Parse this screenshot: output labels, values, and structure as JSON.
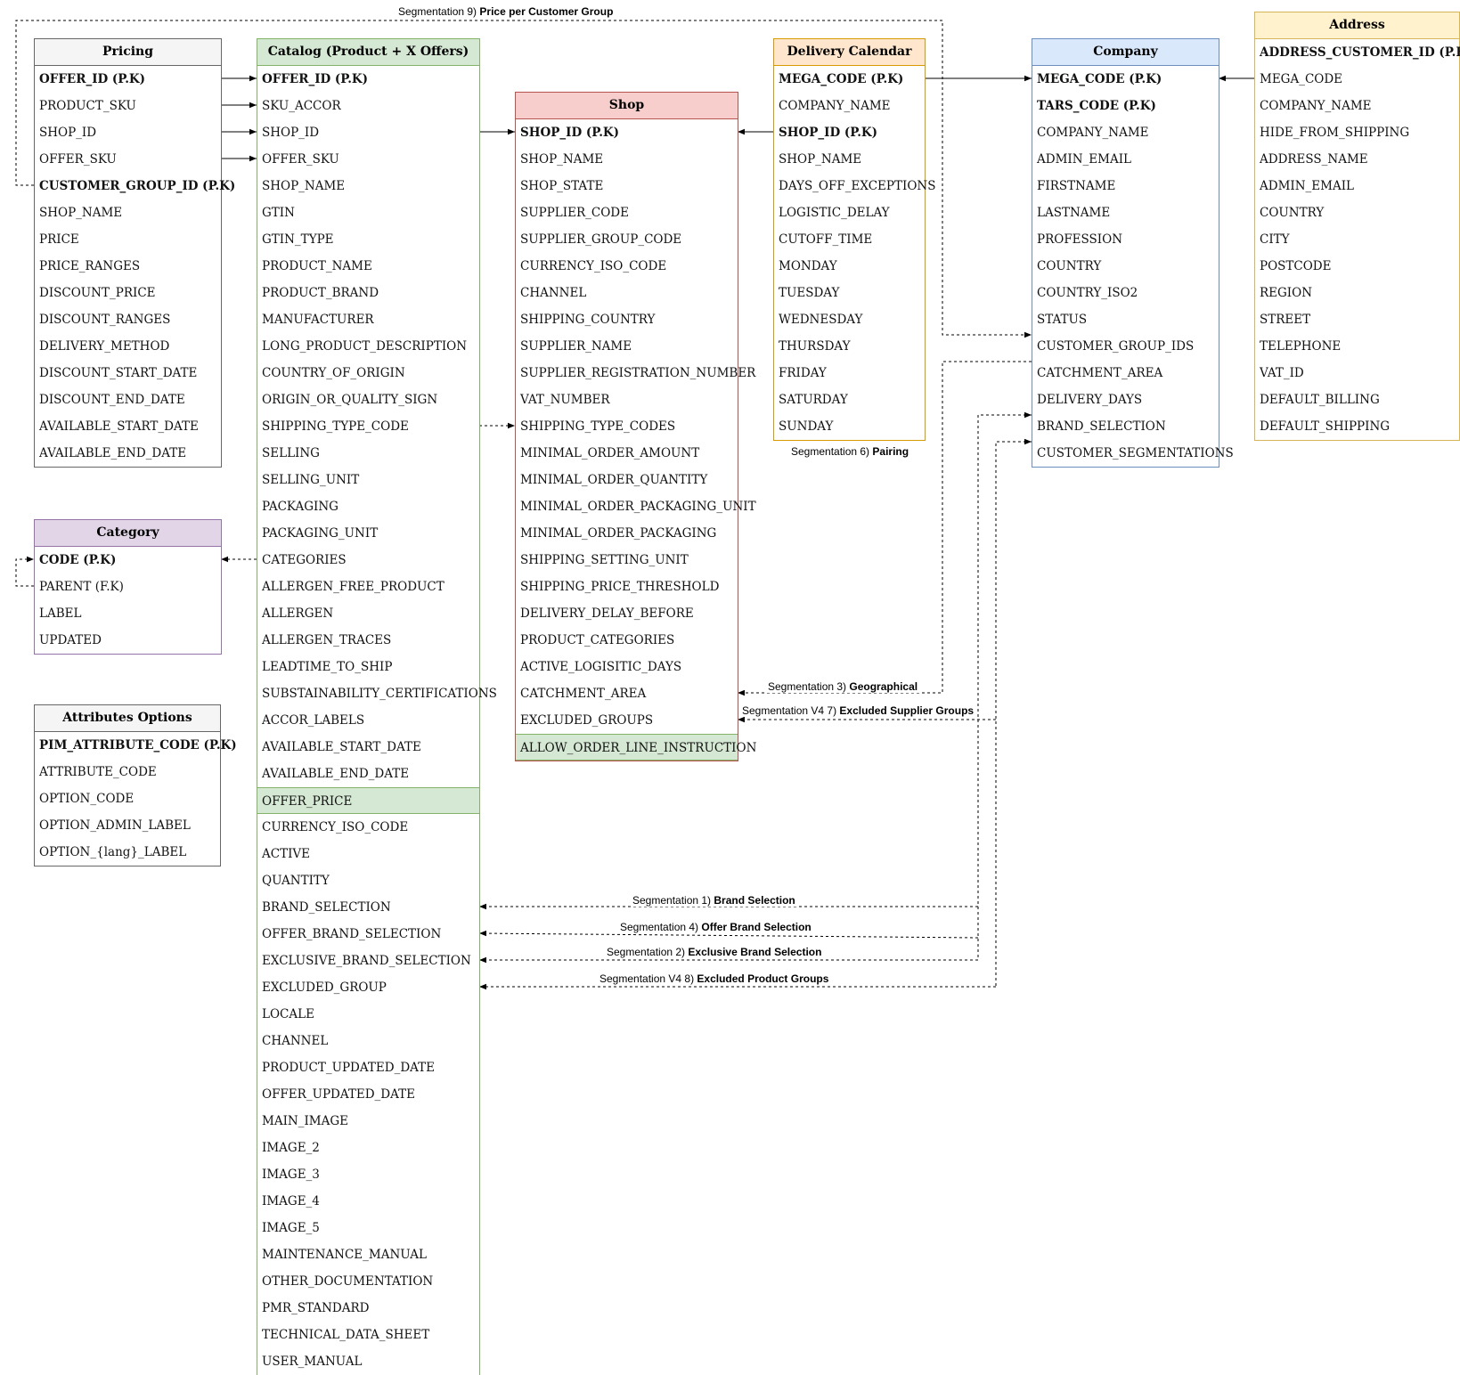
{
  "tables": {
    "pricing": {
      "title": "Pricing",
      "rows": [
        "OFFER_ID (P.K)",
        "PRODUCT_SKU",
        "SHOP_ID",
        "OFFER_SKU",
        "CUSTOMER_GROUP_ID (P.K)",
        "SHOP_NAME",
        "PRICE",
        "PRICE_RANGES",
        "DISCOUNT_PRICE",
        "DISCOUNT_RANGES",
        "DELIVERY_METHOD",
        "DISCOUNT_START_DATE",
        "DISCOUNT_END_DATE",
        "AVAILABLE_START_DATE",
        "AVAILABLE_END_DATE"
      ],
      "pk": [
        0,
        4
      ],
      "colors": {
        "header_bg": "#f5f5f5",
        "border": "#666666"
      }
    },
    "catalog": {
      "title": "Catalog (Product + X Offers)",
      "rows": [
        "OFFER_ID (P.K)",
        "SKU_ACCOR",
        "SHOP_ID",
        "OFFER_SKU",
        "SHOP_NAME",
        "GTIN",
        "GTIN_TYPE",
        "PRODUCT_NAME",
        "PRODUCT_BRAND",
        "MANUFACTURER",
        "LONG_PRODUCT_DESCRIPTION",
        "COUNTRY_OF_ORIGIN",
        "ORIGIN_OR_QUALITY_SIGN",
        "SHIPPING_TYPE_CODE",
        "SELLING",
        "SELLING_UNIT",
        "PACKAGING",
        "PACKAGING_UNIT",
        "CATEGORIES",
        "ALLERGEN_FREE_PRODUCT",
        "ALLERGEN",
        "ALLERGEN_TRACES",
        "LEADTIME_TO_SHIP",
        "SUBSTAINABILITY_CERTIFICATIONS",
        "ACCOR_LABELS",
        "AVAILABLE_START_DATE",
        "AVAILABLE_END_DATE",
        "OFFER_PRICE",
        "CURRENCY_ISO_CODE",
        "ACTIVE",
        "QUANTITY",
        "BRAND_SELECTION",
        "OFFER_BRAND_SELECTION",
        "EXCLUSIVE_BRAND_SELECTION",
        "EXCLUDED_GROUP",
        "LOCALE",
        "CHANNEL",
        "PRODUCT_UPDATED_DATE",
        "OFFER_UPDATED_DATE",
        "MAIN_IMAGE",
        "IMAGE_2",
        "IMAGE_3",
        "IMAGE_4",
        "IMAGE_5",
        "MAINTENANCE_MANUAL",
        "OTHER_DOCUMENTATION",
        "PMR_STANDARD",
        "TECHNICAL_DATA_SHEET",
        "USER_MANUAL"
      ],
      "pk": [
        0
      ],
      "band": [
        27
      ],
      "colors": {
        "header_bg": "#d5e8d4",
        "border": "#82b366"
      }
    },
    "shop": {
      "title": "Shop",
      "rows": [
        "SHOP_ID (P.K)",
        "SHOP_NAME",
        "SHOP_STATE",
        "SUPPLIER_CODE",
        "SUPPLIER_GROUP_CODE",
        "CURRENCY_ISO_CODE",
        "CHANNEL",
        "SHIPPING_COUNTRY",
        "SUPPLIER_NAME",
        "SUPPLIER_REGISTRATION_NUMBER",
        "VAT_NUMBER",
        "SHIPPING_TYPE_CODES",
        "MINIMAL_ORDER_AMOUNT",
        "MINIMAL_ORDER_QUANTITY",
        "MINIMAL_ORDER_PACKAGING_UNIT",
        "MINIMAL_ORDER_PACKAGING",
        "SHIPPING_SETTING_UNIT",
        "SHIPPING_PRICE_THRESHOLD",
        "DELIVERY_DELAY_BEFORE",
        "PRODUCT_CATEGORIES",
        "ACTIVE_LOGISITIC_DAYS",
        "CATCHMENT_AREA",
        "EXCLUDED_GROUPS",
        "ALLOW_ORDER_LINE_INSTRUCTION"
      ],
      "pk": [
        0
      ],
      "band": [
        23
      ],
      "colors": {
        "header_bg": "#f8cecc",
        "border": "#b85450"
      }
    },
    "delivery": {
      "title": "Delivery Calendar",
      "rows": [
        "MEGA_CODE (P.K)",
        "COMPANY_NAME",
        "SHOP_ID (P.K)",
        "SHOP_NAME",
        "DAYS_OFF_EXCEPTIONS",
        "LOGISTIC_DELAY",
        "CUTOFF_TIME",
        "MONDAY",
        "TUESDAY",
        "WEDNESDAY",
        "THURSDAY",
        "FRIDAY",
        "SATURDAY",
        "SUNDAY"
      ],
      "pk": [
        0,
        2
      ],
      "colors": {
        "header_bg": "#ffe6cc",
        "border": "#d79b00"
      }
    },
    "company": {
      "title": "Company",
      "rows": [
        "MEGA_CODE (P.K)",
        "TARS_CODE (P.K)",
        "COMPANY_NAME",
        "ADMIN_EMAIL",
        "FIRSTNAME",
        "LASTNAME",
        "PROFESSION",
        "COUNTRY",
        "COUNTRY_ISO2",
        "STATUS",
        "CUSTOMER_GROUP_IDS",
        "CATCHMENT_AREA",
        "DELIVERY_DAYS",
        "BRAND_SELECTION",
        "CUSTOMER_SEGMENTATIONS"
      ],
      "pk": [
        0,
        1
      ],
      "colors": {
        "header_bg": "#dae8fc",
        "border": "#6c8ebf"
      }
    },
    "address": {
      "title": "Address",
      "rows": [
        "ADDRESS_CUSTOMER_ID (P.K)",
        "MEGA_CODE",
        "COMPANY_NAME",
        "HIDE_FROM_SHIPPING",
        "ADDRESS_NAME",
        "ADMIN_EMAIL",
        "COUNTRY",
        "CITY",
        "POSTCODE",
        "REGION",
        "STREET",
        "TELEPHONE",
        "VAT_ID",
        "DEFAULT_BILLING",
        "DEFAULT_SHIPPING"
      ],
      "pk": [
        0
      ],
      "colors": {
        "header_bg": "#fff2cc",
        "border": "#d6b656"
      }
    },
    "category": {
      "title": "Category",
      "rows": [
        "CODE (P.K)",
        "PARENT (F.K)",
        "LABEL",
        "UPDATED"
      ],
      "pk": [
        0
      ],
      "colors": {
        "header_bg": "#e1d5e7",
        "border": "#9673a6"
      }
    },
    "attributes": {
      "title": "Attributes Options",
      "rows": [
        "PIM_ATTRIBUTE_CODE (P.K)",
        "ATTRIBUTE_CODE",
        "OPTION_CODE",
        "OPTION_ADMIN_LABEL",
        "OPTION_{lang}_LABEL"
      ],
      "pk": [
        0
      ],
      "colors": {
        "header_bg": "#f5f5f5",
        "border": "#666666"
      }
    }
  },
  "labels": {
    "seg9": {
      "prefix": "Segmentation 9) ",
      "bold": "Price per Customer Group"
    },
    "seg6": {
      "prefix": "Segmentation 6) ",
      "bold": "Pairing"
    },
    "seg3": {
      "prefix": "Segmentation 3) ",
      "bold": "Geographical"
    },
    "seg7": {
      "prefix": "Segmentation V4 7) ",
      "bold": "Excluded Supplier Groups"
    },
    "seg1": {
      "prefix": "Segmentation 1) ",
      "bold": "Brand Selection"
    },
    "seg4": {
      "prefix": "Segmentation 4) ",
      "bold": "Offer Brand Selection"
    },
    "seg2": {
      "prefix": "Segmentation 2) ",
      "bold": "Exclusive Brand Selection"
    },
    "seg8": {
      "prefix": "Segmentation V4 8) ",
      "bold": "Excluded Product Groups"
    }
  },
  "colors": {
    "line": "#000000",
    "band_bg": "#d5e8d4",
    "band_border": "#82b366"
  }
}
